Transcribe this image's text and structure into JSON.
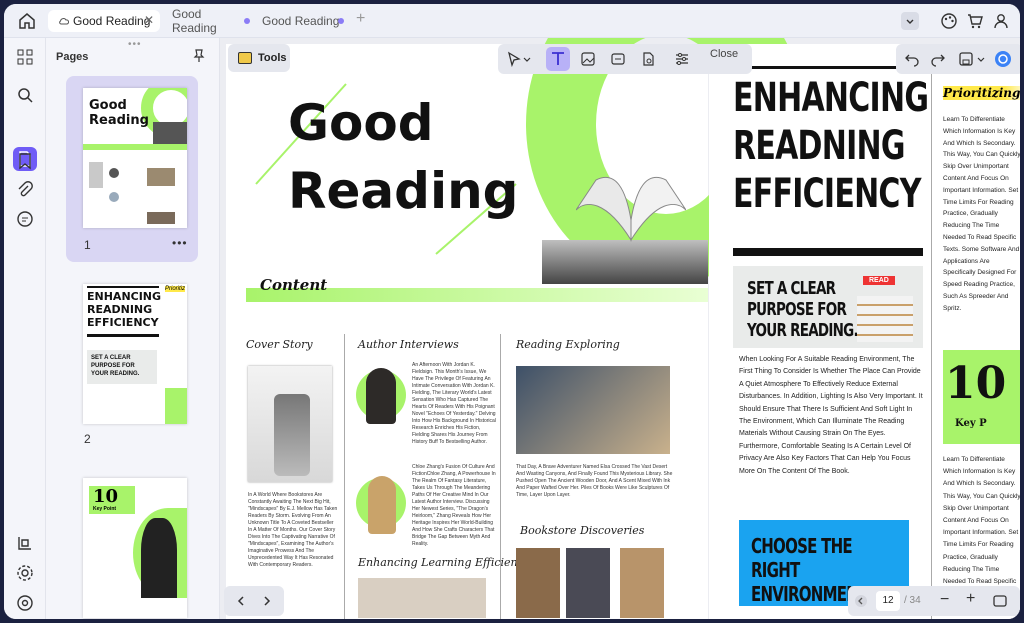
{
  "tabs": [
    {
      "label": "Good Reading",
      "active": true
    },
    {
      "label": "Good Reading",
      "active": false
    },
    {
      "label": "Good Reading",
      "active": false
    }
  ],
  "panel": {
    "title": "Pages"
  },
  "thumbnails": [
    {
      "page": "1"
    },
    {
      "page": "2"
    }
  ],
  "toolbar": {
    "tools_label": "Tools",
    "close_label": "Close"
  },
  "pager": {
    "current": "12",
    "total": "/ 34"
  },
  "doc_left": {
    "title_line1": "Good",
    "title_line2": "Reading",
    "content_label": "Content",
    "col1_heading": "Cover Story",
    "col2_heading": "Author Interviews",
    "col3_heading": "Reading Exploring",
    "col2b_heading": "Enhancing Learning Efficiency",
    "col3b_heading": "Bookstore Discoveries",
    "col1_text": "In A World Where Bookstores Are Constantly Awaiting The Next Big Hit, \"Mindscapes\" By E.J. Mellow Has Taken Readers By Storm. Evolving From An Unknown Title To A Coveted Bestseller In A Matter Of Months. Our Cover Story Dives Into The Captivating Narrative Of \"Mindscapes\", Examining The Author's Imaginative Prowess And The Unprecedented Way It Has Resonated With Contemporary Readers.",
    "col2_text1": "An Afternoon With Jordan K. Fieldsign. This Month's Issue, We Have The Privilege Of Featuring An Intimate Conversation With Jordan K. Fielding, The Literary World's Latest Sensation Who Has Captured The Hearts Of Readers With His Poignant Novel \"Echoes Of Yesterday.\" Delving Into How His Background In Historical Research Enriches His Fiction, Fielding Shares His Journey From History Buff To Bestselling Author.",
    "col2_text2": "Chloe Zhang's Fusion Of Culture And FictionChloe Zhang, A Powerhouse In The Realm Of Fantasy Literature, Takes Us Through The Meandering Paths Of Her Creative Mind In Our Latest Author Interview. Discussing Her Newest Series, \"The Dragon's Heirloom,\" Zhang Reveals How Her Heritage Inspires Her World-Building And How She Crafts Characters That Bridge The Gap Between Myth And Reality.",
    "col3_text": "That Day, A Brave Adventurer Named Elsa Crossed The Vast Desert And Wasting Canyons, And Finally Found This Mysterious Library. She Pushed Open The Ancient Wooden Door, And A Scent Mixed With Ink And Paper Wafted Over Her. Piles Of Books Were Like Sculptures Of Time, Layer Upon Layer."
  },
  "doc_right": {
    "headline": [
      "ENHANCING",
      "READNING",
      "EFFICIENCY"
    ],
    "callout1": [
      "SET A CLEAR",
      "PURPOSE FOR",
      "YOUR READING."
    ],
    "read_badge": "READ",
    "body": "When Looking For A Suitable Reading Environment, The First Thing To Consider Is Whether The Place Can Provide A Quiet Atmosphere To Effectively Reduce External Disturbances. In Addition, Lighting Is Also Very Important. It Should Ensure That There Is Sufficient And Soft Light In The Environment, Which Can Illuminate The Reading Materials Without Causing Strain On The Eyes. Furthermore, Comfortable Seating Is A Certain Level Of Privacy Are Also Key Factors That Can Help You Focus More On The Content Of The Book.",
    "callout2": [
      "CHOOSE THE RIGHT",
      "ENVIRONMENT"
    ],
    "side_heading": "Prioritizing",
    "side_text": "Learn To Differentiate Which Information Is Key And Which Is Secondary. This Way, You Can Quickly Skip Over Unimportant Content And Focus On Important Information. Set Time Limits For Reading Practice, Gradually Reducing The Time Needed To Read Specific Texts. Some Software And Applications Are Specifically Designed For Speed Reading Practice, Such As Spreeder And Spritz.",
    "side_big": "10",
    "side_key": "Key P",
    "side_text2": "Learn To Differentiate Which Information Is Key And Which Is Secondary. This Way, You Can Quickly Skip Over Unimportant Content And Focus On Important Information. Set Time Limits For Reading Practice, Gradually Reducing The Time Needed To Read Specific Texts."
  },
  "thumb2": {
    "headline": [
      "ENHANCING",
      "READNING",
      "EFFICIENCY"
    ],
    "callout": [
      "SET A CLEAR",
      "PURPOSE FOR",
      "YOUR READING."
    ],
    "side_heading": "Prioritiz"
  },
  "thumb3": {
    "big": "10",
    "key": "Key Point"
  },
  "colors": {
    "accent": "#6f5cf6",
    "lime": "#a8f36a",
    "blue": "#1aa3f0"
  }
}
